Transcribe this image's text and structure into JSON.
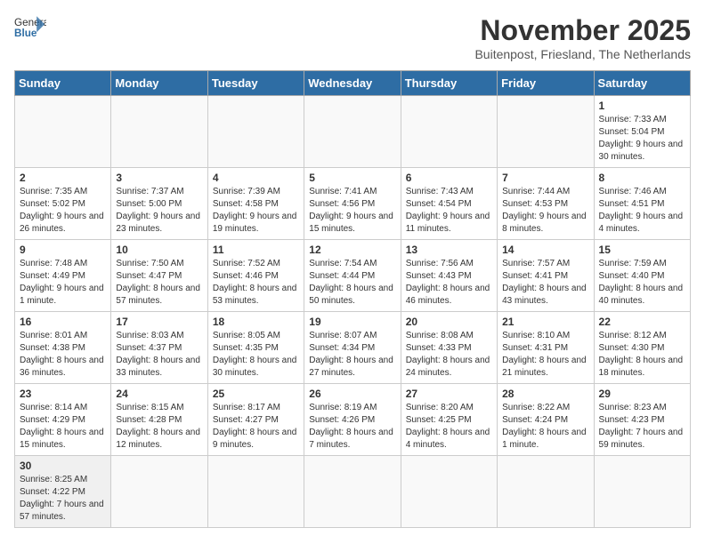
{
  "logo": {
    "text_general": "General",
    "text_blue": "Blue"
  },
  "title": "November 2025",
  "subtitle": "Buitenpost, Friesland, The Netherlands",
  "headers": [
    "Sunday",
    "Monday",
    "Tuesday",
    "Wednesday",
    "Thursday",
    "Friday",
    "Saturday"
  ],
  "days": [
    {
      "number": "",
      "info": ""
    },
    {
      "number": "",
      "info": ""
    },
    {
      "number": "",
      "info": ""
    },
    {
      "number": "",
      "info": ""
    },
    {
      "number": "",
      "info": ""
    },
    {
      "number": "",
      "info": ""
    },
    {
      "number": "1",
      "info": "Sunrise: 7:33 AM\nSunset: 5:04 PM\nDaylight: 9 hours and 30 minutes."
    },
    {
      "number": "2",
      "info": "Sunrise: 7:35 AM\nSunset: 5:02 PM\nDaylight: 9 hours and 26 minutes."
    },
    {
      "number": "3",
      "info": "Sunrise: 7:37 AM\nSunset: 5:00 PM\nDaylight: 9 hours and 23 minutes."
    },
    {
      "number": "4",
      "info": "Sunrise: 7:39 AM\nSunset: 4:58 PM\nDaylight: 9 hours and 19 minutes."
    },
    {
      "number": "5",
      "info": "Sunrise: 7:41 AM\nSunset: 4:56 PM\nDaylight: 9 hours and 15 minutes."
    },
    {
      "number": "6",
      "info": "Sunrise: 7:43 AM\nSunset: 4:54 PM\nDaylight: 9 hours and 11 minutes."
    },
    {
      "number": "7",
      "info": "Sunrise: 7:44 AM\nSunset: 4:53 PM\nDaylight: 9 hours and 8 minutes."
    },
    {
      "number": "8",
      "info": "Sunrise: 7:46 AM\nSunset: 4:51 PM\nDaylight: 9 hours and 4 minutes."
    },
    {
      "number": "9",
      "info": "Sunrise: 7:48 AM\nSunset: 4:49 PM\nDaylight: 9 hours and 1 minute."
    },
    {
      "number": "10",
      "info": "Sunrise: 7:50 AM\nSunset: 4:47 PM\nDaylight: 8 hours and 57 minutes."
    },
    {
      "number": "11",
      "info": "Sunrise: 7:52 AM\nSunset: 4:46 PM\nDaylight: 8 hours and 53 minutes."
    },
    {
      "number": "12",
      "info": "Sunrise: 7:54 AM\nSunset: 4:44 PM\nDaylight: 8 hours and 50 minutes."
    },
    {
      "number": "13",
      "info": "Sunrise: 7:56 AM\nSunset: 4:43 PM\nDaylight: 8 hours and 46 minutes."
    },
    {
      "number": "14",
      "info": "Sunrise: 7:57 AM\nSunset: 4:41 PM\nDaylight: 8 hours and 43 minutes."
    },
    {
      "number": "15",
      "info": "Sunrise: 7:59 AM\nSunset: 4:40 PM\nDaylight: 8 hours and 40 minutes."
    },
    {
      "number": "16",
      "info": "Sunrise: 8:01 AM\nSunset: 4:38 PM\nDaylight: 8 hours and 36 minutes."
    },
    {
      "number": "17",
      "info": "Sunrise: 8:03 AM\nSunset: 4:37 PM\nDaylight: 8 hours and 33 minutes."
    },
    {
      "number": "18",
      "info": "Sunrise: 8:05 AM\nSunset: 4:35 PM\nDaylight: 8 hours and 30 minutes."
    },
    {
      "number": "19",
      "info": "Sunrise: 8:07 AM\nSunset: 4:34 PM\nDaylight: 8 hours and 27 minutes."
    },
    {
      "number": "20",
      "info": "Sunrise: 8:08 AM\nSunset: 4:33 PM\nDaylight: 8 hours and 24 minutes."
    },
    {
      "number": "21",
      "info": "Sunrise: 8:10 AM\nSunset: 4:31 PM\nDaylight: 8 hours and 21 minutes."
    },
    {
      "number": "22",
      "info": "Sunrise: 8:12 AM\nSunset: 4:30 PM\nDaylight: 8 hours and 18 minutes."
    },
    {
      "number": "23",
      "info": "Sunrise: 8:14 AM\nSunset: 4:29 PM\nDaylight: 8 hours and 15 minutes."
    },
    {
      "number": "24",
      "info": "Sunrise: 8:15 AM\nSunset: 4:28 PM\nDaylight: 8 hours and 12 minutes."
    },
    {
      "number": "25",
      "info": "Sunrise: 8:17 AM\nSunset: 4:27 PM\nDaylight: 8 hours and 9 minutes."
    },
    {
      "number": "26",
      "info": "Sunrise: 8:19 AM\nSunset: 4:26 PM\nDaylight: 8 hours and 7 minutes."
    },
    {
      "number": "27",
      "info": "Sunrise: 8:20 AM\nSunset: 4:25 PM\nDaylight: 8 hours and 4 minutes."
    },
    {
      "number": "28",
      "info": "Sunrise: 8:22 AM\nSunset: 4:24 PM\nDaylight: 8 hours and 1 minute."
    },
    {
      "number": "29",
      "info": "Sunrise: 8:23 AM\nSunset: 4:23 PM\nDaylight: 7 hours and 59 minutes."
    },
    {
      "number": "30",
      "info": "Sunrise: 8:25 AM\nSunset: 4:22 PM\nDaylight: 7 hours and 57 minutes."
    }
  ]
}
